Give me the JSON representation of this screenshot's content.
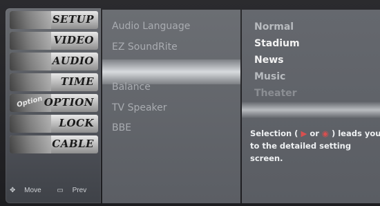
{
  "left_menu": {
    "items": [
      {
        "label": "SETUP"
      },
      {
        "label": "VIDEO"
      },
      {
        "label": "AUDIO"
      },
      {
        "label": "TIME"
      },
      {
        "label": "OPTION",
        "thumb_text": "Option"
      },
      {
        "label": "LOCK"
      },
      {
        "label": "CABLE"
      }
    ],
    "footer": {
      "move": "Move",
      "prev": "Prev"
    }
  },
  "audio_menu": {
    "items": [
      "Audio Language",
      "EZ SoundRite",
      "",
      "Balance",
      "TV Speaker",
      "BBE"
    ]
  },
  "sound_options": {
    "items": [
      "Normal",
      "Stadium",
      "News",
      "Music",
      "Theater"
    ]
  },
  "help": {
    "line1_prefix": "Selection (",
    "line1_arrow": "▶",
    "line1_or": "or",
    "line1_button": "◉",
    "line1_suffix": ") leads you",
    "line2": "to the detailed setting",
    "line3": "screen."
  }
}
